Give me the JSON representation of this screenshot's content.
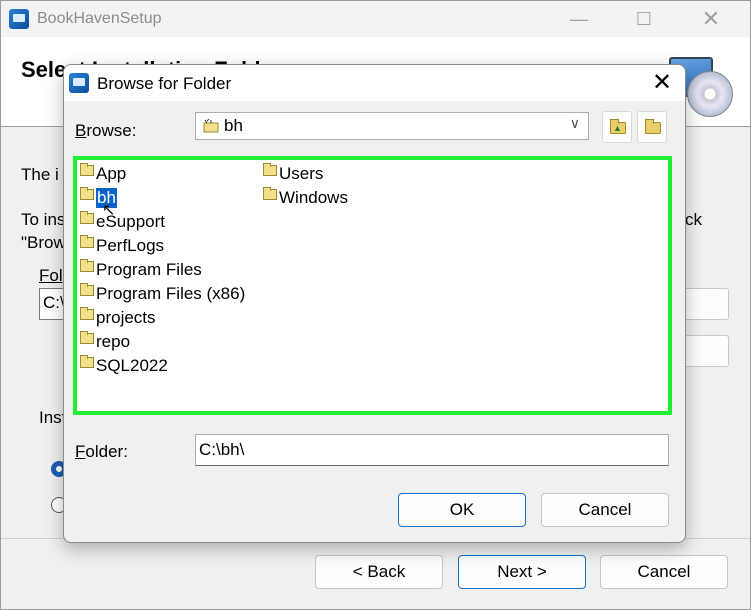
{
  "main_window": {
    "title": "BookHavenSetup",
    "header_title": "Select Installation Folder",
    "body_text_1": "The i",
    "body_text_2a": "To ins",
    "body_text_2b": "\"Brow",
    "body_text_2c": "ck",
    "folder_label_frag": "Fol",
    "folder_value_frag": "C:\\",
    "install_for_frag": "Inst",
    "buttons": {
      "back": "< Back",
      "next": "Next >",
      "cancel": "Cancel"
    }
  },
  "dialog": {
    "title": "Browse for Folder",
    "browse_label_key": "B",
    "browse_label_rest": "rowse:",
    "browse_value": "bh",
    "tree_columns": [
      [
        "App",
        "bh",
        "eSupport",
        "PerfLogs",
        "Program Files",
        "Program Files (x86)",
        "projects",
        "repo",
        "SQL2022"
      ],
      [
        "Users",
        "Windows"
      ]
    ],
    "selected_item": "bh",
    "folder_label_key": "F",
    "folder_label_rest": "older:",
    "folder_value": "C:\\bh\\",
    "ok_label": "OK",
    "cancel_label": "Cancel"
  },
  "colors": {
    "highlight_border": "#22ee33",
    "selection": "#0a64c8",
    "default_button_border": "#1a73c8"
  }
}
